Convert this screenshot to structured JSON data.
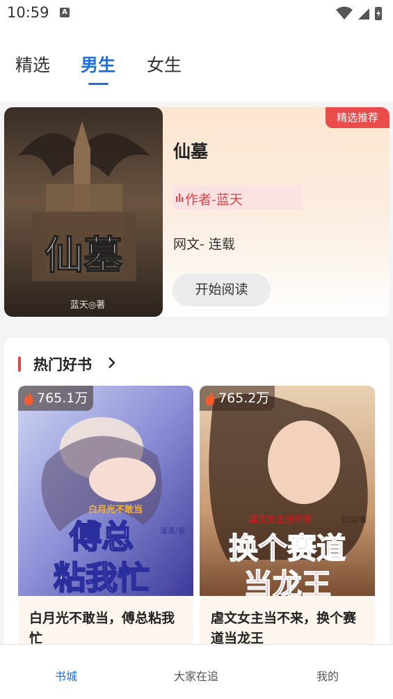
{
  "status_bar": {
    "time": "10:59",
    "notification_icon": "A"
  },
  "tabs": [
    {
      "label": "精选",
      "active": false
    },
    {
      "label": "男生",
      "active": true
    },
    {
      "label": "女生",
      "active": false
    }
  ],
  "featured": {
    "badge": "精选推荐",
    "title": "仙墓",
    "author": "作者-蓝天",
    "meta": "网文- 连载",
    "read_button": "开始阅读",
    "cover_title": "仙墓",
    "cover_author": "蓝天◎著"
  },
  "hot": {
    "section_title": "热门好书",
    "books": [
      {
        "views": "765.1万",
        "name": "白月光不敢当，傅总粘我忙",
        "cover_top": "白月光不敢当",
        "cover_line1": "傅总",
        "cover_line2": "粘我忙",
        "cover_author": "潘潘/著"
      },
      {
        "views": "765.2万",
        "name": "虐文女主当不来，换个赛道当龙王",
        "cover_top": "虐文女主当不来",
        "cover_line1": "换个赛道",
        "cover_line2": "当龙王",
        "cover_author": "归羽/著"
      }
    ]
  },
  "bottom_nav": [
    {
      "label": "书城",
      "active": true
    },
    {
      "label": "大家在追",
      "active": false
    },
    {
      "label": "我的",
      "active": false
    }
  ],
  "colors": {
    "accent": "#1f6fe0",
    "badge": "#ea4b4b",
    "author": "#e64545"
  }
}
